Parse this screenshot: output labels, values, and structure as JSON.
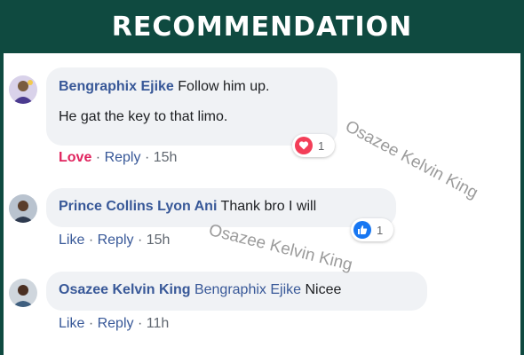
{
  "header": {
    "title": "RECOMMENDATION"
  },
  "comments": [
    {
      "author": "Bengraphix Ejike",
      "lines": [
        "Follow him up.",
        "He gat the key to that limo."
      ],
      "actions": {
        "primary": "Love",
        "reply": "Reply",
        "time": "15h",
        "sep": "·"
      },
      "reaction": {
        "icon": "heart-icon",
        "count": "1",
        "color": "#f33e58"
      }
    },
    {
      "author": "Prince Collins Lyon Ani",
      "text": "Thank bro I will",
      "actions": {
        "primary": "Like",
        "reply": "Reply",
        "time": "15h",
        "sep": "·"
      },
      "reaction": {
        "icon": "thumbs-up-icon",
        "count": "1",
        "color": "#1877f2"
      }
    },
    {
      "author": "Osazee Kelvin King",
      "mention": "Bengraphix Ejike",
      "text": "Nicee",
      "actions": {
        "primary": "Like",
        "reply": "Reply",
        "time": "11h",
        "sep": "·"
      }
    }
  ],
  "watermarks": [
    "Osazee Kelvin King",
    "Osazee Kelvin King"
  ],
  "colors": {
    "header_bg": "#0f4a40",
    "link": "#385898",
    "love": "#e0245e"
  }
}
